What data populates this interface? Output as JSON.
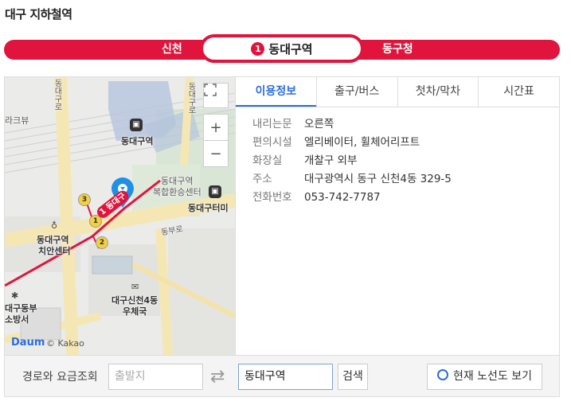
{
  "page_title": "대구 지하철역",
  "line": {
    "prev_station": "신천",
    "current_station": "동대구역",
    "current_line_number": "1",
    "next_station": "동구청",
    "color": "#e0143c"
  },
  "map": {
    "labels": {
      "station": "동대구역",
      "transfer_center_line1": "동대구역",
      "transfer_center_line2": "복합환승센터",
      "bus_terminal": "동대구터미",
      "police_line1": "동대구역",
      "police_line2": "치안센터",
      "post_line1": "대구신천4동",
      "post_line2": "우체국",
      "fire_line1": "대구동부",
      "fire_line2": "소방서",
      "left_top": "라크뷰",
      "road_vertical_left": "동대구로",
      "road_vertical_right": "동대구로",
      "road_right": "동부로",
      "marker_station": "동대구",
      "copyright": "© Kakao",
      "logo": "Daum"
    },
    "exits": [
      "1",
      "2",
      "3"
    ],
    "controls": {
      "fullscreen_icon": "fullscreen-icon",
      "zoom_in": "+",
      "zoom_out": "−"
    }
  },
  "tabs": [
    "이용정보",
    "출구/버스",
    "첫차/막차",
    "시간표"
  ],
  "info": [
    {
      "key": "내리는문",
      "value": "오른쪽"
    },
    {
      "key": "편의시설",
      "value": "엘리베이터, 휠체어리프트"
    },
    {
      "key": "화장실",
      "value": "개찰구 외부"
    },
    {
      "key": "주소",
      "value": "대구광역시 동구 신천4동 329-5"
    },
    {
      "key": "전화번호",
      "value": "053-742-7787"
    }
  ],
  "route": {
    "label": "경로와 요금조회",
    "from_placeholder": "출발지",
    "to_value": "동대구역",
    "search_label": "검색",
    "route_map_label": "현재 노선도 보기"
  }
}
